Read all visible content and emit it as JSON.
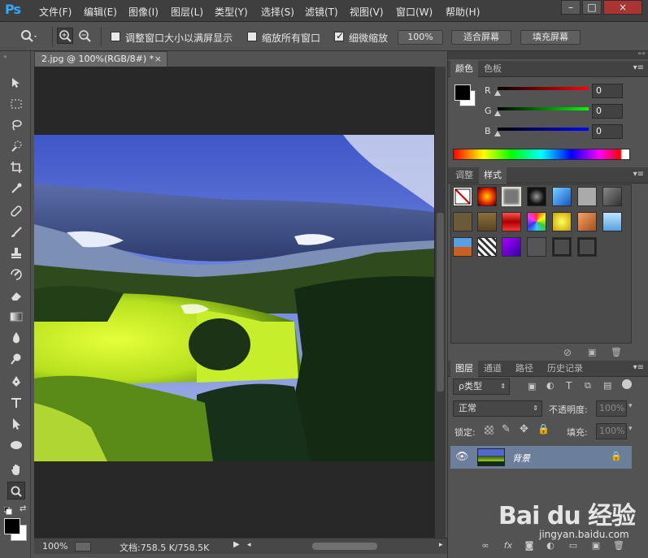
{
  "app": {
    "logo": "Ps"
  },
  "menu": [
    "文件(F)",
    "编辑(E)",
    "图像(I)",
    "图层(L)",
    "类型(Y)",
    "选择(S)",
    "滤镜(T)",
    "视图(V)",
    "窗口(W)",
    "帮助(H)"
  ],
  "window_controls": {
    "minimize": "–",
    "maximize": "□",
    "close": "×"
  },
  "options": {
    "resize_windows": "调整窗口大小以满屏显示",
    "zoom_all": "缩放所有窗口",
    "scrubby_zoom": "细微缩放",
    "zoom_value": "100%",
    "fit_screen": "适合屏幕",
    "fill_screen": "填充屏幕"
  },
  "document": {
    "tab_title": "2.jpg @ 100%(RGB/8#) *",
    "close": "×"
  },
  "status": {
    "zoom": "100%",
    "doc_size": "文档:758.5 K/758.5K"
  },
  "color_panel": {
    "tabs": [
      "颜色",
      "色板"
    ],
    "channels": [
      {
        "label": "R",
        "value": "0"
      },
      {
        "label": "G",
        "value": "0"
      },
      {
        "label": "B",
        "value": "0"
      }
    ]
  },
  "styles_panel": {
    "tabs": [
      "调整",
      "样式"
    ]
  },
  "layers_panel": {
    "tabs": [
      "图层",
      "通道",
      "路径",
      "历史记录"
    ],
    "filter": "ρ类型",
    "blend_mode": "正常",
    "opacity_label": "不透明度:",
    "opacity_value": "100%",
    "lock_label": "锁定:",
    "fill_label": "填充:",
    "fill_value": "100%",
    "layer_name": "背景"
  },
  "watermark": {
    "logo": "Bai du 经验",
    "url": "jingyan.baidu.com"
  },
  "colors": {
    "accent": "#31a8ff",
    "selected_layer": "#6b7e9a"
  }
}
